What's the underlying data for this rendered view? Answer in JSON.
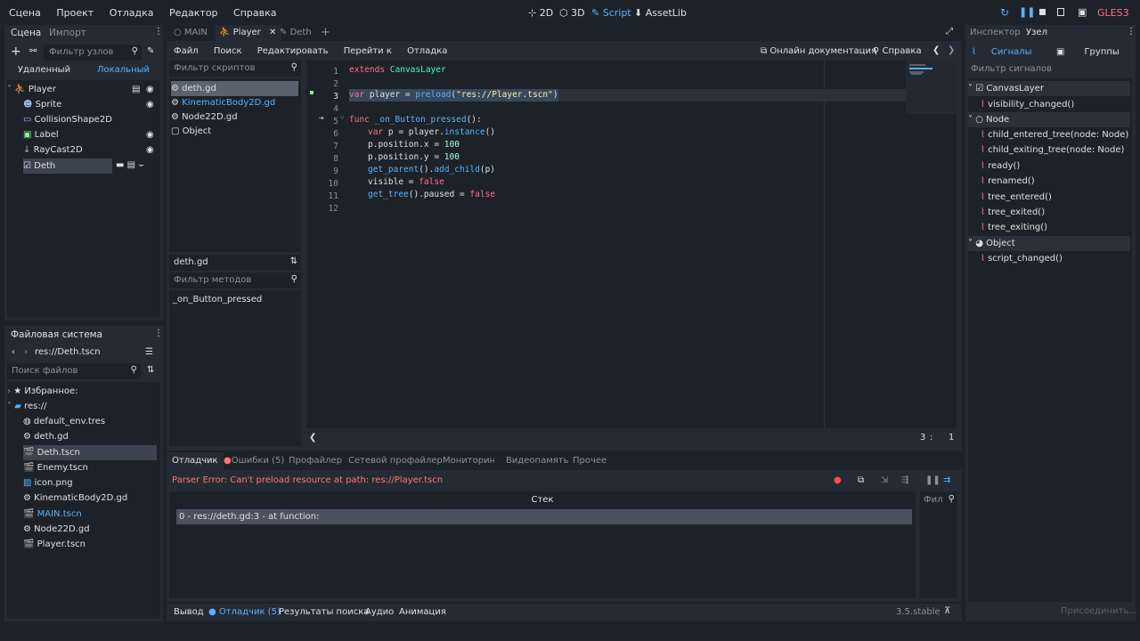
{
  "topbar": {
    "menus": [
      "Сцена",
      "Проект",
      "Отладка",
      "Редактор",
      "Справка"
    ],
    "modes": [
      "2D",
      "3D",
      "Script",
      "AssetLib"
    ],
    "renderer": "GLES3"
  },
  "scene_dock": {
    "tabs": [
      "Сцена",
      "Импорт"
    ],
    "filter_placeholder": "Фильтр узлов",
    "view_buttons": [
      "Удаленный",
      "Локальный"
    ],
    "nodes": [
      "Player",
      "Sprite",
      "CollisionShape2D",
      "Label",
      "RayCast2D",
      "Deth"
    ]
  },
  "fs_dock": {
    "title": "Файловая система",
    "path": "res://Deth.tscn",
    "search_placeholder": "Поиск файлов",
    "favorites": "Избранное:",
    "root": "res://",
    "files": [
      "default_env.tres",
      "deth.gd",
      "Deth.tscn",
      "Enemy.tscn",
      "icon.png",
      "KinematicBody2D.gd",
      "MAIN.tscn",
      "Node22D.gd",
      "Player.tscn"
    ]
  },
  "scene_tabs": [
    "MAIN",
    "Player",
    "Deth"
  ],
  "script_menu": [
    "Файл",
    "Поиск",
    "Редактировать",
    "Перейти к",
    "Отладка"
  ],
  "script_right": {
    "docs": "Онлайн документация",
    "help": "Справка"
  },
  "scripts_filter_placeholder": "Фильтр скриптов",
  "scripts": [
    "deth.gd",
    "KinematicBody2D.gd",
    "Node22D.gd",
    "Object"
  ],
  "current_script": "deth.gd",
  "methods_filter_placeholder": "Фильтр методов",
  "methods": [
    "_on_Button_pressed"
  ],
  "code_lines": [
    {
      "n": "1",
      "t": "extends CanvasLayer"
    },
    {
      "n": "2",
      "t": ""
    },
    {
      "n": "3",
      "t": "var player = preload(\"res://Player.tscn\")"
    },
    {
      "n": "4",
      "t": ""
    },
    {
      "n": "5",
      "t": "func _on_Button_pressed():"
    },
    {
      "n": "6",
      "t": "    var p = player.instance()"
    },
    {
      "n": "7",
      "t": "    p.position.x = 100"
    },
    {
      "n": "8",
      "t": "    p.position.y = 100"
    },
    {
      "n": "9",
      "t": "    get_parent().add_child(p)"
    },
    {
      "n": "10",
      "t": "    visible = false"
    },
    {
      "n": "11",
      "t": "    get_tree().paused = false"
    },
    {
      "n": "12",
      "t": ""
    }
  ],
  "cursor": {
    "line": "3",
    "col": "1"
  },
  "debugger": {
    "tabs": [
      "Отладчик",
      "Ошибки (5)",
      "Профайлер",
      "Сетевой профайлер",
      "Мониторинг",
      "Видеопамять",
      "Прочее"
    ],
    "error": "Parser Error: Can't preload resource at path: res://Player.tscn",
    "stack_header": "Стек",
    "stack_rows": [
      "0 - res://deth.gd:3 - at function:"
    ],
    "filter": "Фил"
  },
  "bottom_tabs": [
    "Вывод",
    "Отладчик (5)",
    "Результаты поиска",
    "Аудио",
    "Анимация"
  ],
  "version": "3.5.stable",
  "right_dock": {
    "tabs": [
      "Инспектор",
      "Узел"
    ],
    "sub_tabs": [
      "Сигналы",
      "Группы"
    ],
    "filter_placeholder": "Фильтр сигналов",
    "groups": [
      {
        "name": "CanvasLayer",
        "signals": [
          "visibility_changed()"
        ]
      },
      {
        "name": "Node",
        "signals": [
          "child_entered_tree(node: Node)",
          "child_exiting_tree(node: Node)",
          "ready()",
          "renamed()",
          "tree_entered()",
          "tree_exited()",
          "tree_exiting()"
        ]
      },
      {
        "name": "Object",
        "signals": [
          "script_changed()"
        ]
      }
    ],
    "connect_button": "Присоединить..."
  },
  "colors": {
    "accent": "#57b3ff",
    "keyword": "#ff7085",
    "type": "#42ffc2",
    "string": "#ffeda1",
    "number": "#a1ffe0",
    "error": "#ff786b"
  }
}
